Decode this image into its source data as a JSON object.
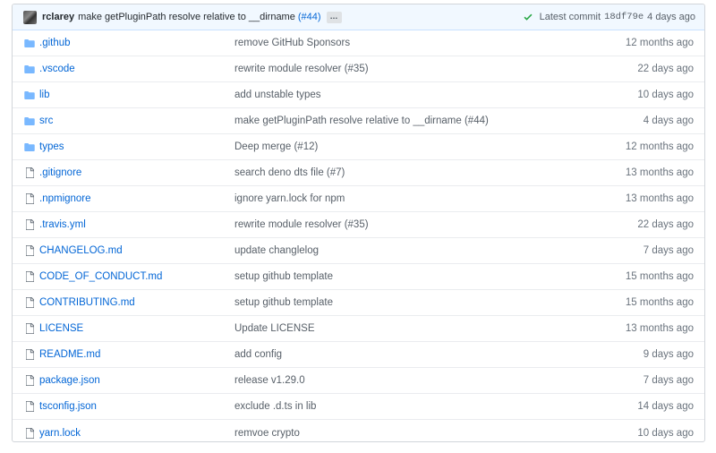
{
  "header": {
    "author": "rclarey",
    "message": "make getPluginPath resolve relative to __dirname",
    "pr_link": "(#44)",
    "ellipsis": "…",
    "latest_label": "Latest commit",
    "sha": "18df79e",
    "time": "4 days ago",
    "status_icon": "check-icon",
    "status_color": "#28a745"
  },
  "files": [
    {
      "type": "folder",
      "name": ".github",
      "commit": "remove GitHub Sponsors",
      "age": "12 months ago"
    },
    {
      "type": "folder",
      "name": ".vscode",
      "commit": "rewrite module resolver (#35)",
      "age": "22 days ago"
    },
    {
      "type": "folder",
      "name": "lib",
      "commit": "add unstable types",
      "age": "10 days ago"
    },
    {
      "type": "folder",
      "name": "src",
      "commit": "make getPluginPath resolve relative to __dirname (#44)",
      "age": "4 days ago"
    },
    {
      "type": "folder",
      "name": "types",
      "commit": "Deep merge (#12)",
      "age": "12 months ago"
    },
    {
      "type": "file",
      "name": ".gitignore",
      "commit": "search deno dts file (#7)",
      "age": "13 months ago"
    },
    {
      "type": "file",
      "name": ".npmignore",
      "commit": "ignore yarn.lock for npm",
      "age": "13 months ago"
    },
    {
      "type": "file",
      "name": ".travis.yml",
      "commit": "rewrite module resolver (#35)",
      "age": "22 days ago"
    },
    {
      "type": "file",
      "name": "CHANGELOG.md",
      "commit": "update changlelog",
      "age": "7 days ago"
    },
    {
      "type": "file",
      "name": "CODE_OF_CONDUCT.md",
      "commit": "setup github template",
      "age": "15 months ago"
    },
    {
      "type": "file",
      "name": "CONTRIBUTING.md",
      "commit": "setup github template",
      "age": "15 months ago"
    },
    {
      "type": "file",
      "name": "LICENSE",
      "commit": "Update LICENSE",
      "age": "13 months ago"
    },
    {
      "type": "file",
      "name": "README.md",
      "commit": "add config",
      "age": "9 days ago"
    },
    {
      "type": "file",
      "name": "package.json",
      "commit": "release v1.29.0",
      "age": "7 days ago"
    },
    {
      "type": "file",
      "name": "tsconfig.json",
      "commit": "exclude .d.ts in lib",
      "age": "14 days ago"
    },
    {
      "type": "file",
      "name": "yarn.lock",
      "commit": "remvoe crypto",
      "age": "10 days ago"
    }
  ],
  "colors": {
    "link": "#0366d6",
    "folder_icon": "#79b8ff",
    "file_icon": "#6a737d",
    "header_bg": "#f1f8ff"
  }
}
